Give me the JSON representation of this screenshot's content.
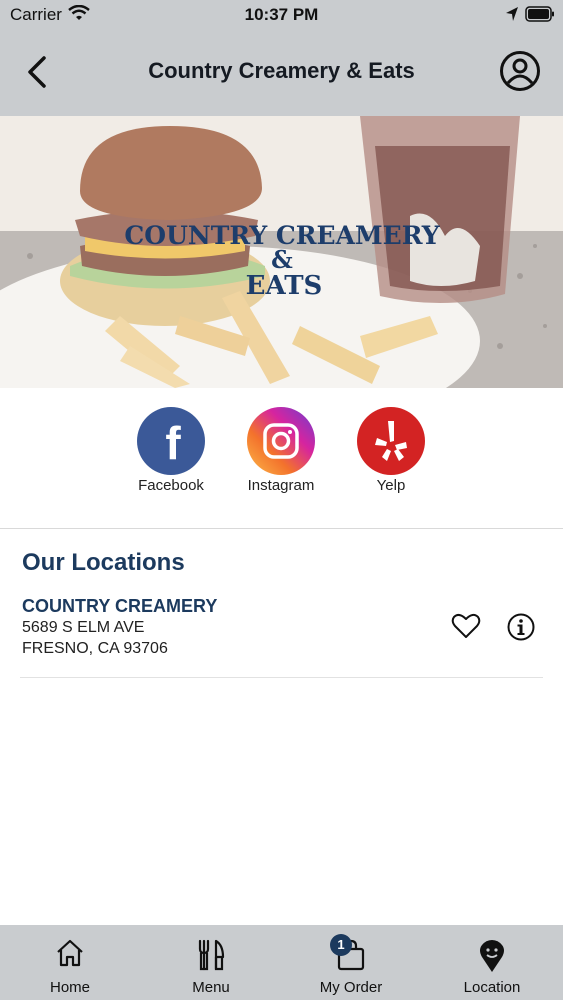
{
  "status_bar": {
    "carrier": "Carrier",
    "time": "10:37 PM"
  },
  "header": {
    "title": "Country Creamery & Eats"
  },
  "hero": {
    "logo_line1": "COUNTRY CREAMERY",
    "logo_line2": "&",
    "logo_line3": "EATS"
  },
  "social": [
    {
      "label": "Facebook",
      "icon": "facebook-icon",
      "color": "#3b5998"
    },
    {
      "label": "Instagram",
      "icon": "instagram-icon",
      "color": "#d6249f"
    },
    {
      "label": "Yelp",
      "icon": "yelp-icon",
      "color": "#d32323"
    }
  ],
  "locations": {
    "title": "Our Locations",
    "items": [
      {
        "name": "COUNTRY CREAMERY",
        "address1": "5689 S ELM AVE",
        "address2": "FRESNO, CA 93706"
      }
    ]
  },
  "tabs": [
    {
      "label": "Home",
      "icon": "home-icon"
    },
    {
      "label": "Menu",
      "icon": "utensils-icon"
    },
    {
      "label": "My Order",
      "icon": "shopping-bag-icon",
      "badge": "1"
    },
    {
      "label": "Location",
      "icon": "location-pin-icon"
    }
  ],
  "colors": {
    "accent": "#1c3a5e",
    "bar_bg": "#c9cccf"
  }
}
